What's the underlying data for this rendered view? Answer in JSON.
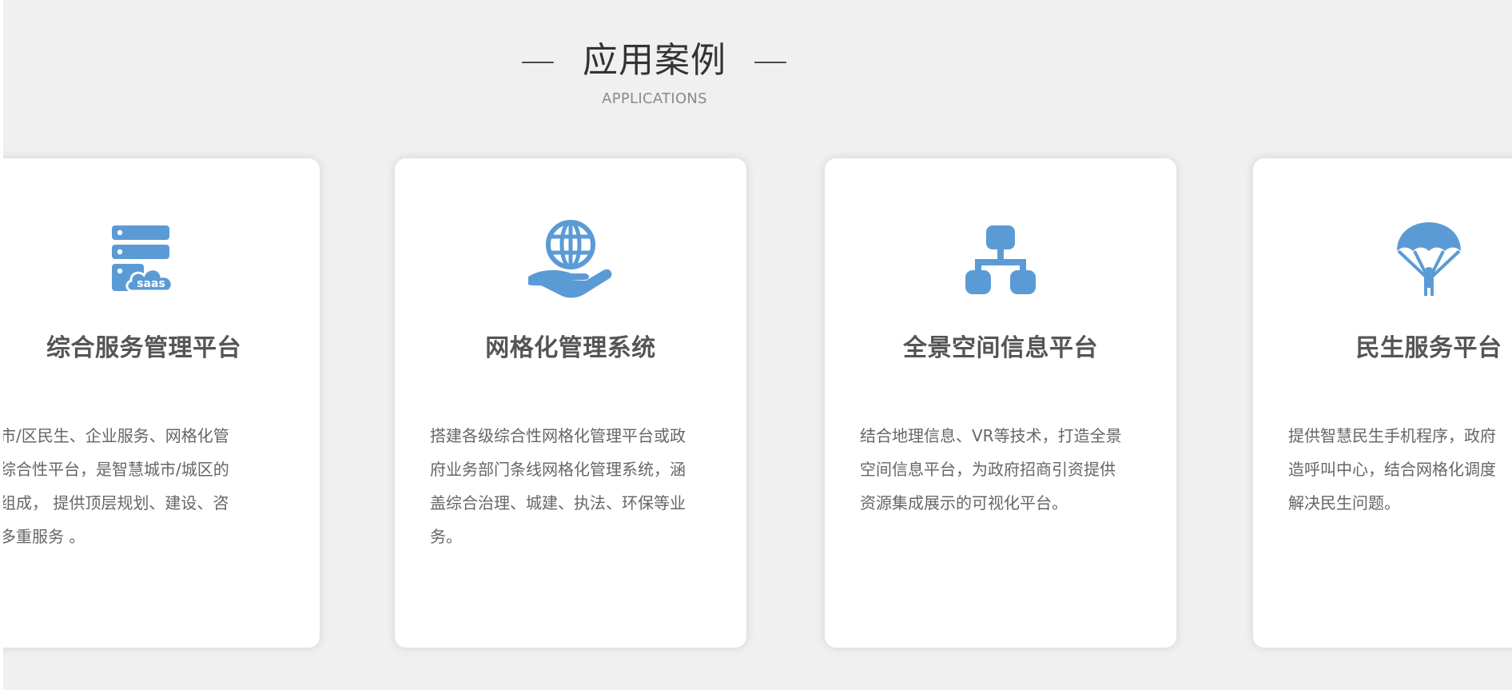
{
  "header": {
    "title": "应用案例",
    "dash_left": "—",
    "dash_right": "—",
    "subtitle": "APPLICATIONS"
  },
  "accent_color": "#5b9bd5",
  "cards": [
    {
      "icon": "saas-server-icon",
      "title": "综合服务管理平台",
      "desc_lines": [
        "搭建市/区民生、企业服务、网格化管",
        "理等综合性平台，是智慧城市/城区的",
        "重要组成， 提供顶层规划、建设、咨",
        "询等多重服务 。"
      ]
    },
    {
      "icon": "globe-hand-icon",
      "title": "网格化管理系统",
      "desc_lines": [
        "搭建各级综合性网格化管理平台或政",
        "府业务部门条线网格化管理系统，涵",
        "盖综合治理、城建、执法、环保等业",
        "务。"
      ]
    },
    {
      "icon": "network-nodes-icon",
      "title": "全景空间信息平台",
      "desc_lines": [
        "结合地理信息、VR等技术，打造全景",
        "空间信息平台，为政府招商引资提供",
        "资源集成展示的可视化平台。"
      ]
    },
    {
      "icon": "parachute-icon",
      "title": "民生服务平台",
      "desc_lines": [
        "提供智慧民生手机程序，政府",
        "造呼叫中心，结合网格化调度",
        "解决民生问题。"
      ]
    }
  ]
}
